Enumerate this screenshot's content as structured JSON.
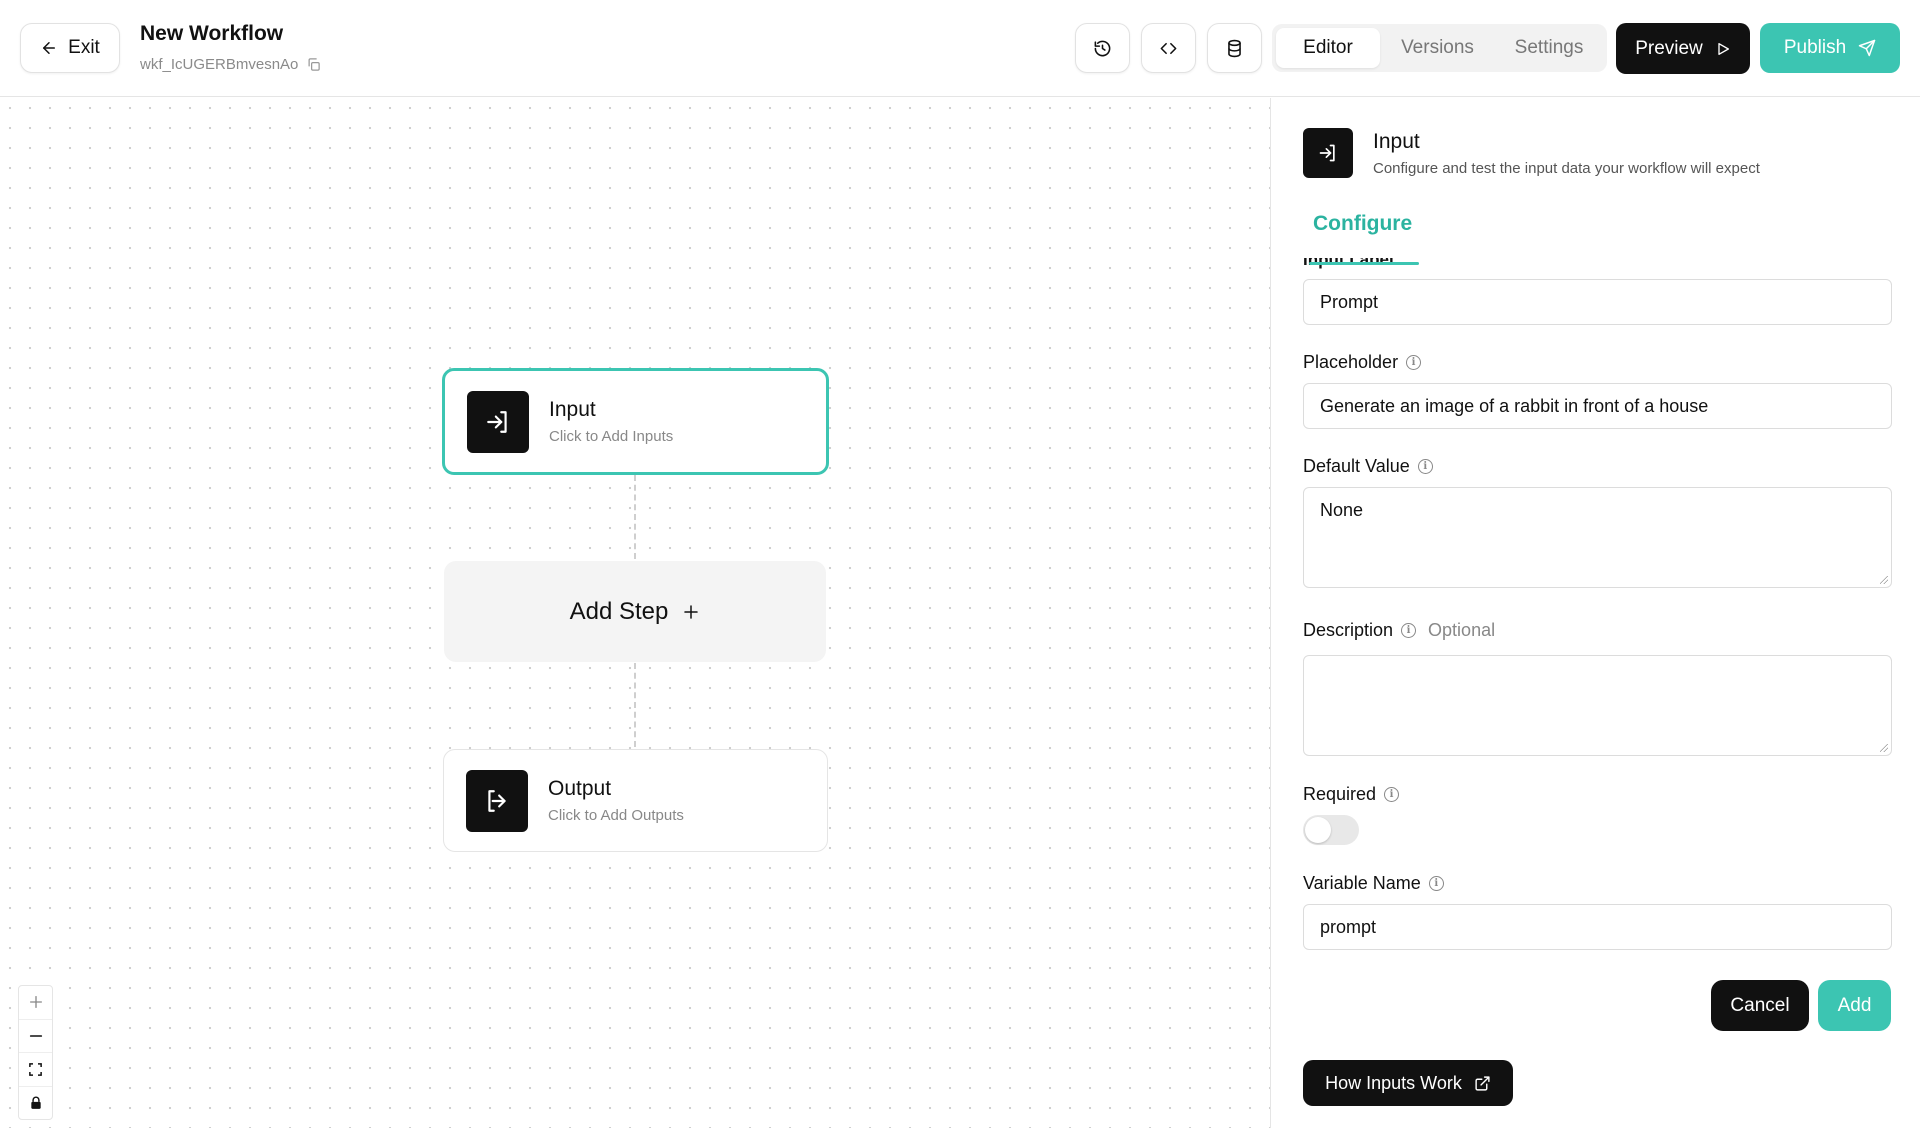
{
  "header": {
    "exit_label": "Exit",
    "workflow_title": "New Workflow",
    "workflow_id": "wkf_IcUGERBmvesnAo",
    "tabs": [
      {
        "label": "Editor",
        "active": true
      },
      {
        "label": "Versions",
        "active": false
      },
      {
        "label": "Settings",
        "active": false
      }
    ],
    "preview_label": "Preview",
    "publish_label": "Publish"
  },
  "canvas": {
    "input_node": {
      "title": "Input",
      "subtitle": "Click to Add Inputs"
    },
    "add_step_label": "Add Step",
    "output_node": {
      "title": "Output",
      "subtitle": "Click to Add Outputs"
    }
  },
  "panel": {
    "title": "Input",
    "subtitle": "Configure and test the input data your workflow will expect",
    "configure_tab": "Configure",
    "input_label_partial": "Input Label",
    "input_label_value": "Prompt",
    "placeholder_label": "Placeholder",
    "placeholder_value": "Generate an image of a rabbit in front of a house",
    "default_value_label": "Default Value",
    "default_value": "None",
    "description_label": "Description",
    "description_optional": "Optional",
    "description_value": "",
    "required_label": "Required",
    "required_on": false,
    "variable_name_label": "Variable Name",
    "variable_name_value": "prompt",
    "cancel_label": "Cancel",
    "add_label": "Add",
    "how_label": "How Inputs Work"
  },
  "colors": {
    "accent": "#3cc5b2",
    "dark": "#111111"
  }
}
